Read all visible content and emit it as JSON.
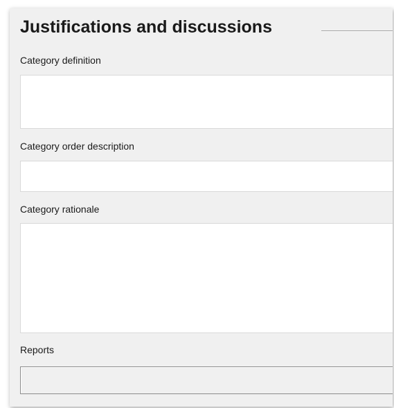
{
  "section": {
    "title": "Justifications and discussions"
  },
  "fields": {
    "category_definition": {
      "label": "Category definition",
      "value": ""
    },
    "category_order_description": {
      "label": "Category order description",
      "value": ""
    },
    "category_rationale": {
      "label": "Category rationale",
      "value": ""
    },
    "reports": {
      "label": "Reports",
      "value": ""
    }
  }
}
